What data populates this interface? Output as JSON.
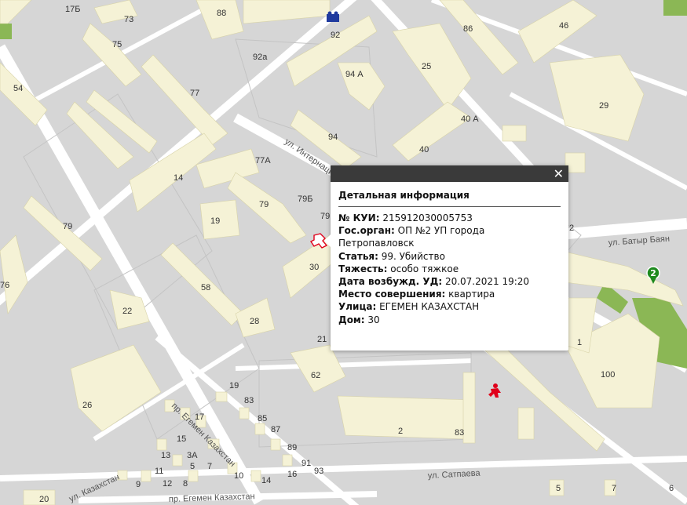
{
  "map": {
    "building_numbers": [
      "17Б",
      "73",
      "88",
      "92",
      "92а",
      "86",
      "46",
      "75",
      "54",
      "77",
      "94 А",
      "25",
      "29",
      "40 А",
      "94",
      "40",
      "77А",
      "14",
      "79",
      "79Б",
      "79",
      "19",
      "79",
      "76",
      "58",
      "30",
      "28",
      "22",
      "21",
      "62",
      "100",
      "26",
      "19",
      "17",
      "83",
      "85",
      "87",
      "15",
      "13",
      "3А",
      "5",
      "7",
      "11",
      "9",
      "12",
      "8",
      "10",
      "14",
      "16",
      "89",
      "91",
      "93",
      "2",
      "83",
      "2",
      "20",
      "5",
      "7",
      "6",
      "1"
    ],
    "streets": [
      "ул. Интернационал",
      "ул. Батыр Баян",
      "ул. Сатпаева",
      "пр. Егемен Казахстан",
      "пр. Егемен Казахстан",
      "ул. Казахстан"
    ],
    "marker_badge": "2",
    "colors": {
      "road": "#ffffff",
      "block": "#d6d6d6",
      "building": "#f5f2d6",
      "park": "#8bb755",
      "crime": "#e0001a",
      "police": "#1f3a9e"
    }
  },
  "popup": {
    "title": "Детальная информация",
    "close": "✕",
    "rows": [
      {
        "label": "№ КУИ:",
        "value": " 215912030005753"
      },
      {
        "label": "Гос.орган:",
        "value": " ОП №2 УП города Петропавловск"
      },
      {
        "label": "Статья:",
        "value": " 99. Убийство"
      },
      {
        "label": "Тяжесть:",
        "value": " особо тяжкое"
      },
      {
        "label": "Дата возбужд. УД:",
        "value": " 20.07.2021 19:20"
      },
      {
        "label": "Место совершения:",
        "value": " квартира"
      },
      {
        "label": "Улица:",
        "value": " ЕГЕМЕН КАЗАХСТАН"
      },
      {
        "label": "Дом:",
        "value": " 30"
      }
    ]
  }
}
